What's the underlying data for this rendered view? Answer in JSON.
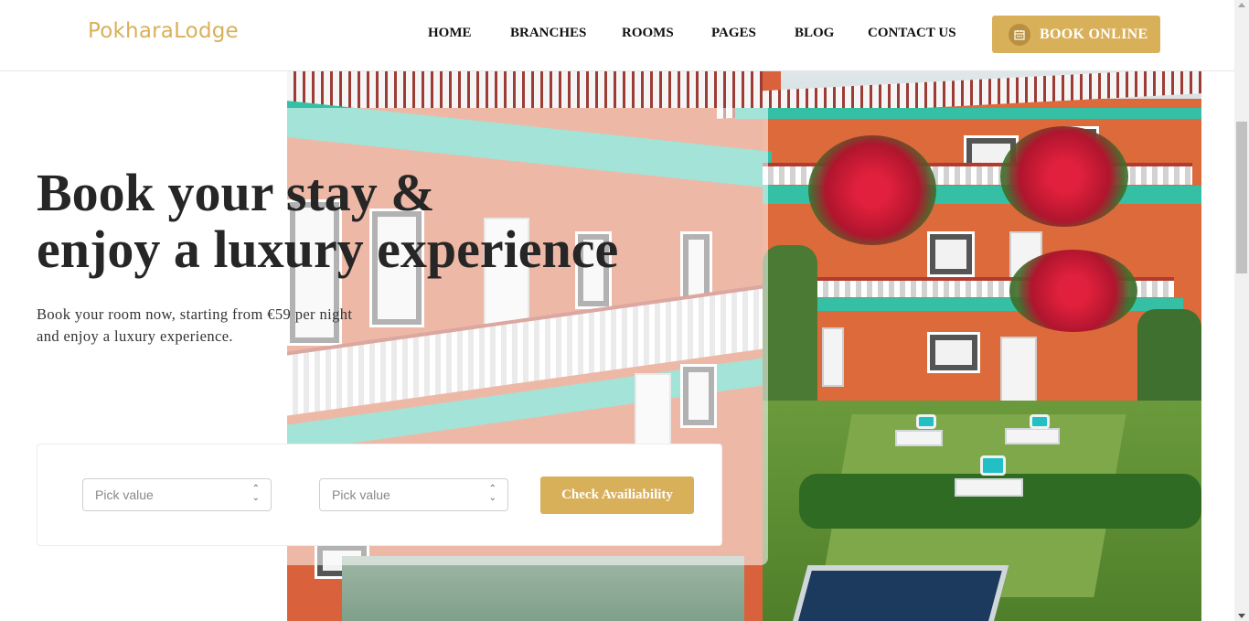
{
  "brand": {
    "logo": "PokharaLodge",
    "accent_color": "#d9b05a"
  },
  "nav": {
    "items": [
      {
        "label": "HOME"
      },
      {
        "label": "BRANCHES"
      },
      {
        "label": "ROOMS"
      },
      {
        "label": "PAGES"
      },
      {
        "label": "BLOG"
      },
      {
        "label": "CONTACT US"
      }
    ],
    "book_label": "BOOK ONLINE",
    "book_icon": "calendar-icon"
  },
  "hero": {
    "headline_line1": "Book your stay &",
    "headline_line2": "enjoy a luxury experience",
    "sub_line1": "Book your room now, starting from €59 per night",
    "sub_line2": "and enjoy a luxury experience."
  },
  "booking": {
    "checkin_placeholder": "Pick value",
    "checkout_placeholder": "Pick value",
    "check_label": "Check Availiability",
    "select_icon": "updown-chevron-icon"
  }
}
